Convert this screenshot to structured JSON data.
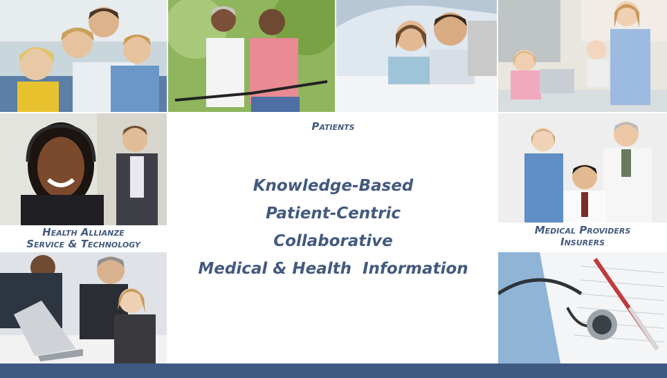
{
  "captions": {
    "patients": "Patients",
    "health_line1": "Health Allianze",
    "health_line2": "Service & Technology",
    "providers_line1": "Medical Providers",
    "providers_line2": "Insurers"
  },
  "center_lines": [
    "Knowledge-Based",
    "Patient-Centric",
    "Collaborative",
    "Medical & Health  Information"
  ],
  "colors": {
    "caption_text": "#435a7e",
    "bottom_bar": "#3f5a82"
  },
  "photos": [
    "family-photo",
    "couple-biking-photo",
    "couple-in-car-photo",
    "mother-children-kitchen-photo",
    "call-center-agent-photo",
    "medical-staff-photo",
    "business-meeting-photo",
    "stethoscope-paperwork-photo"
  ]
}
